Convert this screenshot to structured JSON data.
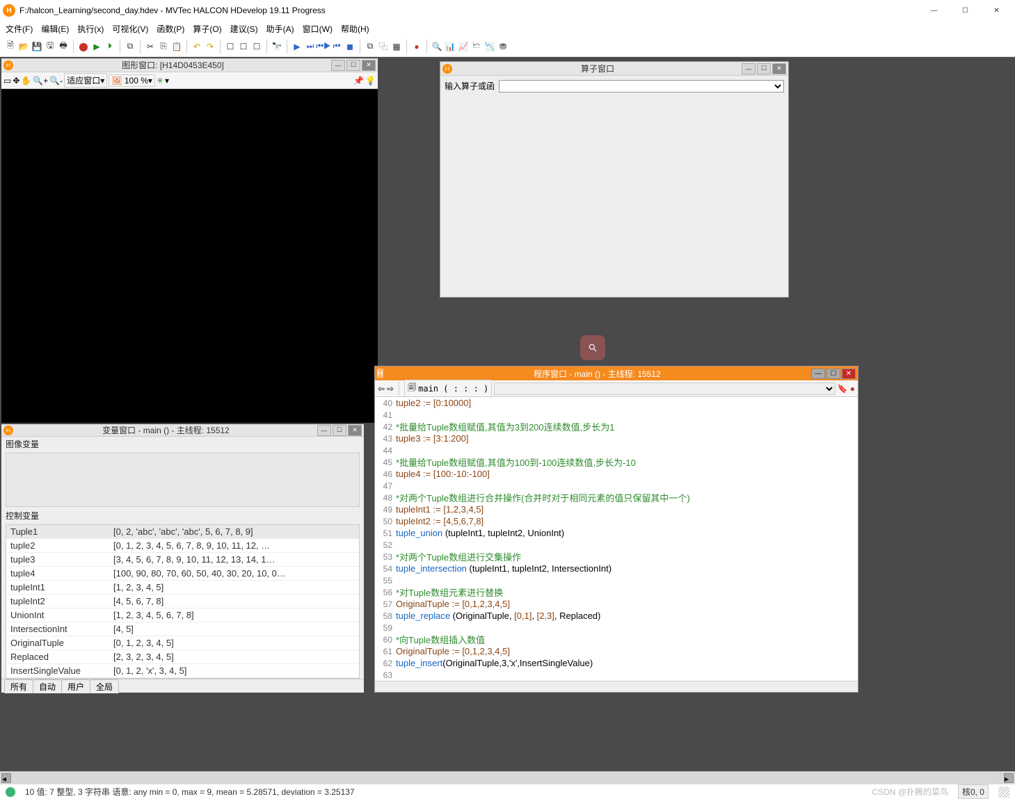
{
  "window": {
    "title": "F:/halcon_Learning/second_day.hdev - MVTec HALCON HDevelop 19.11 Progress",
    "controls": {
      "minimize": "—",
      "maximize": "☐",
      "close": "✕"
    }
  },
  "menubar": {
    "file": "文件(F)",
    "edit": "编辑(E)",
    "exec": "执行(x)",
    "vis": "可视化(V)",
    "func": "函数(P)",
    "ops": "算子(O)",
    "sugg": "建议(S)",
    "assist": "助手(A)",
    "win": "窗口(W)",
    "help": "帮助(H)"
  },
  "graphics": {
    "title": "图形窗口: [H14D0453E450]",
    "fit_label": "适应窗口",
    "zoom_label": "100 %"
  },
  "operator": {
    "title": "算子窗口",
    "label": "输入算子或函"
  },
  "variables": {
    "title": "变量窗口 - main () - 主线程: 15512",
    "imgvar_label": "图像变量",
    "ctrlvar_label": "控制变量",
    "tabs": {
      "all": "所有",
      "auto": "自动",
      "user": "用户",
      "global": "全局"
    },
    "ctrl_rows": [
      {
        "name": "Tuple1",
        "value": "[0, 2, 'abc', 'abc', 'abc', 5, 6, 7, 8, 9]"
      },
      {
        "name": "tuple2",
        "value": "[0, 1, 2, 3, 4, 5, 6, 7, 8, 9, 10, 11, 12, …"
      },
      {
        "name": "tuple3",
        "value": "[3, 4, 5, 6, 7, 8, 9, 10, 11, 12, 13, 14, 1…"
      },
      {
        "name": "tuple4",
        "value": "[100, 90, 80, 70, 60, 50, 40, 30, 20, 10, 0…"
      },
      {
        "name": "tupleInt1",
        "value": "[1, 2, 3, 4, 5]"
      },
      {
        "name": "tupleInt2",
        "value": "[4, 5, 6, 7, 8]"
      },
      {
        "name": "UnionInt",
        "value": "[1, 2, 3, 4, 5, 6, 7, 8]"
      },
      {
        "name": "IntersectionInt",
        "value": "[4, 5]"
      },
      {
        "name": "OriginalTuple",
        "value": "[0, 1, 2, 3, 4, 5]"
      },
      {
        "name": "Replaced",
        "value": "[2, 3, 2, 3, 4, 5]"
      },
      {
        "name": "InsertSingleValue",
        "value": "[0, 1, 2, 'x', 3, 4, 5]"
      }
    ]
  },
  "program": {
    "title": "程序窗口 - main () - 主线程: 15512",
    "crumb": "main ( : : : )",
    "lines": [
      {
        "n": 40,
        "t": "assign",
        "txt": "tuple2 := [0:10000]"
      },
      {
        "n": 41,
        "t": "blank",
        "txt": ""
      },
      {
        "n": 42,
        "t": "comment",
        "txt": "*批量给Tuple数组赋值,其值为3到200连续数值,步长为1"
      },
      {
        "n": 43,
        "t": "assign",
        "txt": "tuple3 := [3:1:200]"
      },
      {
        "n": 44,
        "t": "blank",
        "txt": ""
      },
      {
        "n": 45,
        "t": "comment",
        "txt": "*批量给Tuple数组赋值,其值为100到-100连续数值,步长为-10"
      },
      {
        "n": 46,
        "t": "assign",
        "txt": "tuple4 := [100:-10:-100]"
      },
      {
        "n": 47,
        "t": "blank",
        "txt": ""
      },
      {
        "n": 48,
        "t": "comment",
        "txt": "*对两个Tuple数组进行合并操作(合并时对于相同元素的值只保留其中一个)"
      },
      {
        "n": 49,
        "t": "assign",
        "txt": "tupleInt1 := [1,2,3,4,5]"
      },
      {
        "n": 50,
        "t": "assign",
        "txt": "tupleInt2 := [4,5,6,7,8]"
      },
      {
        "n": 51,
        "t": "call",
        "txt": "tuple_union (tupleInt1, tupleInt2, UnionInt)"
      },
      {
        "n": 52,
        "t": "blank",
        "txt": ""
      },
      {
        "n": 53,
        "t": "comment",
        "txt": "*对两个Tuple数组进行交集操作"
      },
      {
        "n": 54,
        "t": "call",
        "txt": "tuple_intersection (tupleInt1, tupleInt2, IntersectionInt)"
      },
      {
        "n": 55,
        "t": "blank",
        "txt": ""
      },
      {
        "n": 56,
        "t": "comment",
        "txt": "*对Tuple数组元素进行替换"
      },
      {
        "n": 57,
        "t": "assign",
        "txt": "OriginalTuple := [0,1,2,3,4,5]"
      },
      {
        "n": 58,
        "t": "call",
        "txt": "tuple_replace (OriginalTuple, [0,1], [2,3], Replaced)"
      },
      {
        "n": 59,
        "t": "blank",
        "txt": ""
      },
      {
        "n": 60,
        "t": "comment",
        "txt": "*向Tuple数组插入数值"
      },
      {
        "n": 61,
        "t": "assign",
        "txt": "OriginalTuple := [0,1,2,3,4,5]"
      },
      {
        "n": 62,
        "t": "call",
        "txt": "tuple_insert(OriginalTuple,3,'x',InsertSingleValue)"
      },
      {
        "n": 63,
        "t": "blank",
        "txt": ""
      }
    ]
  },
  "status": {
    "text": "10 值: 7 整型, 3 字符串 语意: any min = 0, max = 9, mean = 5.28571, deviation = 3.25137",
    "watermark": "CSDN @扑腾的菜鸟",
    "cursor": "核0, 0"
  }
}
